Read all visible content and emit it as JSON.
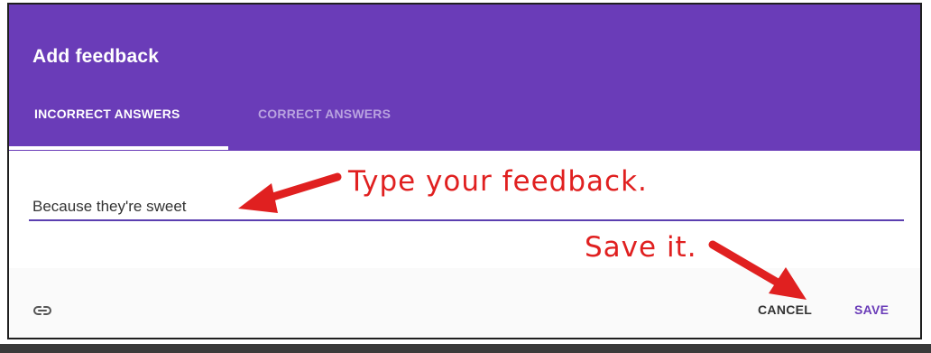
{
  "dialog": {
    "title": "Add feedback",
    "tabs": [
      {
        "label": "INCORRECT ANSWERS",
        "active": true
      },
      {
        "label": "CORRECT ANSWERS",
        "active": false
      }
    ],
    "feedback_value": "Because they're sweet",
    "footer": {
      "link_icon": "link-icon",
      "cancel_label": "CANCEL",
      "save_label": "SAVE"
    }
  },
  "annotations": {
    "type_hint": "Type your feedback.",
    "save_hint": "Save it."
  },
  "colors": {
    "header": "#6a3cb8",
    "accent": "#5b3fb0",
    "annotation": "#e02020"
  }
}
